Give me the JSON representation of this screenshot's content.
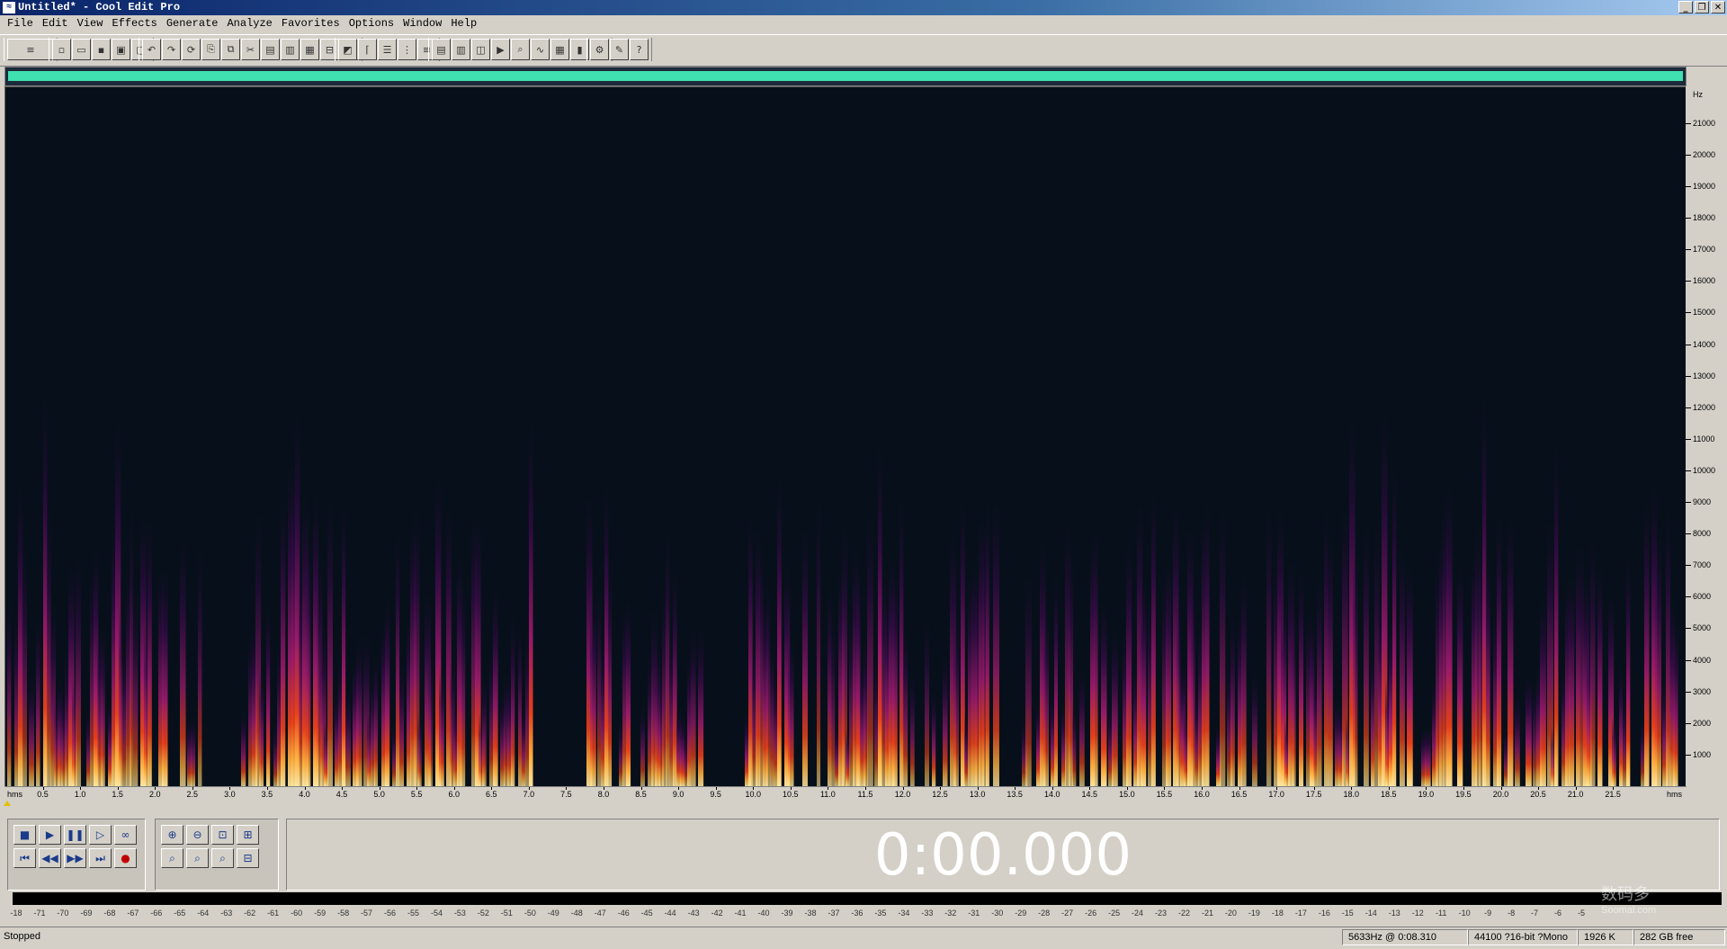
{
  "window": {
    "title": "Untitled* - Cool Edit Pro",
    "app_icon": "cool-edit-icon",
    "buttons": [
      "minimize",
      "restore",
      "close"
    ]
  },
  "menu": [
    "File",
    "Edit",
    "View",
    "Effects",
    "Generate",
    "Analyze",
    "Favorites",
    "Options",
    "Window",
    "Help"
  ],
  "toolbar": {
    "groups": [
      {
        "name": "view-toggle",
        "buttons": [
          "multitrack-toggle-icon"
        ]
      },
      {
        "name": "file",
        "buttons": [
          "new-file-icon",
          "open-file-icon",
          "save-icon",
          "save-as-icon",
          "close-file-icon"
        ]
      },
      {
        "name": "edit",
        "buttons": [
          "undo-icon",
          "redo-icon",
          "repeat-icon",
          "copy-icon",
          "copy-to-new-icon",
          "cut-icon",
          "paste-icon",
          "paste-to-new-icon",
          "mix-paste-icon",
          "trim-icon",
          "crop-icon"
        ]
      },
      {
        "name": "tools",
        "buttons": [
          "spectral-view-icon",
          "envelope-icon",
          "hybrid-icon",
          "selection-icon",
          "scrub-icon"
        ]
      },
      {
        "name": "analyze",
        "buttons": [
          "cue-list-icon",
          "play-list-icon",
          "info-icon",
          "play-icon",
          "zoom-icon",
          "frequency-icon",
          "timing-icon",
          "meter-icon",
          "status-icon"
        ]
      },
      {
        "name": "options",
        "buttons": [
          "settings-icon",
          "scripts-icon",
          "help-icon"
        ]
      }
    ]
  },
  "spectrogram": {
    "freq_unit": "Hz",
    "freq_labels": [
      "21000",
      "20000",
      "19000",
      "18000",
      "17000",
      "16000",
      "15000",
      "14000",
      "13000",
      "12000",
      "11000",
      "10000",
      "9000",
      "8000",
      "7000",
      "6000",
      "5000",
      "4000",
      "3000",
      "2000",
      "1000"
    ],
    "freq_max": 22050,
    "time_unit_left": "hms",
    "time_unit_right": "hms",
    "time_labels": [
      "0.5",
      "1.0",
      "1.5",
      "2.0",
      "2.5",
      "3.0",
      "3.5",
      "4.0",
      "4.5",
      "5.0",
      "5.5",
      "6.0",
      "6.5",
      "7.0",
      "7.5",
      "8.0",
      "8.5",
      "9.0",
      "9.5",
      "10.0",
      "10.5",
      "11.0",
      "11.5",
      "12.0",
      "12.5",
      "13.0",
      "13.5",
      "14.0",
      "14.5",
      "15.0",
      "15.5",
      "16.0",
      "16.5",
      "17.0",
      "17.5",
      "18.0",
      "18.5",
      "19.0",
      "19.5",
      "20.0",
      "20.5",
      "21.0",
      "21.5"
    ],
    "duration_s": 22.4,
    "colors": {
      "background": "#07101a",
      "low": "#3a0a4a",
      "mid": "#9a1a6a",
      "high": "#e8401a",
      "peak": "#ffe8a0"
    }
  },
  "transport": {
    "row1": [
      "stop-icon",
      "play-icon",
      "pause-icon",
      "play-to-end-icon",
      "loop-icon"
    ],
    "row2": [
      "go-to-start-icon",
      "rewind-icon",
      "fast-forward-icon",
      "go-to-end-icon",
      "record-icon"
    ]
  },
  "zoom": {
    "row1": [
      "zoom-in-icon",
      "zoom-out-icon",
      "zoom-full-icon",
      "zoom-vertical-in-icon"
    ],
    "row2": [
      "zoom-left-icon",
      "zoom-right-icon",
      "zoom-selection-icon",
      "zoom-vertical-out-icon"
    ]
  },
  "time_display": {
    "value": "0:00.000"
  },
  "level_meter": {
    "labels": [
      "-18",
      "-71",
      "-70",
      "-69",
      "-68",
      "-67",
      "-66",
      "-65",
      "-64",
      "-63",
      "-62",
      "-61",
      "-60",
      "-59",
      "-58",
      "-57",
      "-56",
      "-55",
      "-54",
      "-53",
      "-52",
      "-51",
      "-50",
      "-49",
      "-48",
      "-47",
      "-46",
      "-45",
      "-44",
      "-43",
      "-42",
      "-41",
      "-40",
      "-39",
      "-38",
      "-37",
      "-36",
      "-35",
      "-34",
      "-33",
      "-32",
      "-31",
      "-30",
      "-29",
      "-28",
      "-27",
      "-26",
      "-25",
      "-24",
      "-23",
      "-22",
      "-21",
      "-20",
      "-19",
      "-18",
      "-17",
      "-16",
      "-15",
      "-14",
      "-13",
      "-12",
      "-11",
      "-10",
      "-9",
      "-8",
      "-7",
      "-6",
      "-5"
    ]
  },
  "status": {
    "state": "Stopped",
    "cursor": "5633Hz @   0:08.310",
    "format": "44100 ?16-bit ?Mono",
    "size": "1926 K",
    "free": "282 GB free"
  },
  "watermark": {
    "text": "数码多",
    "site": "Soomal.com"
  }
}
